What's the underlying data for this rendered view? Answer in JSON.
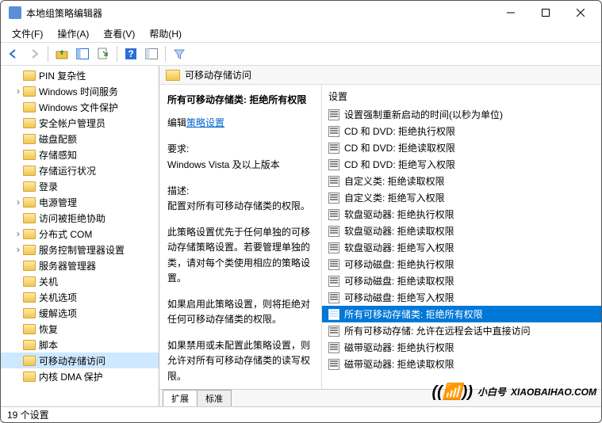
{
  "window": {
    "title": "本地组策略编辑器"
  },
  "menu": {
    "file": "文件(F)",
    "action": "操作(A)",
    "view": "查看(V)",
    "help": "帮助(H)"
  },
  "tree": {
    "items": [
      {
        "label": "PIN 复杂性",
        "exp": ""
      },
      {
        "label": "Windows 时间服务",
        "exp": "›"
      },
      {
        "label": "Windows 文件保护",
        "exp": ""
      },
      {
        "label": "安全帐户管理员",
        "exp": ""
      },
      {
        "label": "磁盘配额",
        "exp": ""
      },
      {
        "label": "存储感知",
        "exp": ""
      },
      {
        "label": "存储运行状况",
        "exp": ""
      },
      {
        "label": "登录",
        "exp": ""
      },
      {
        "label": "电源管理",
        "exp": "›"
      },
      {
        "label": "访问被拒绝协助",
        "exp": ""
      },
      {
        "label": "分布式 COM",
        "exp": "›"
      },
      {
        "label": "服务控制管理器设置",
        "exp": "›"
      },
      {
        "label": "服务器管理器",
        "exp": ""
      },
      {
        "label": "关机",
        "exp": ""
      },
      {
        "label": "关机选项",
        "exp": ""
      },
      {
        "label": "缓解选项",
        "exp": ""
      },
      {
        "label": "恢复",
        "exp": ""
      },
      {
        "label": "脚本",
        "exp": ""
      },
      {
        "label": "可移动存储访问",
        "exp": "",
        "selected": true
      },
      {
        "label": "内核 DMA 保护",
        "exp": ""
      }
    ]
  },
  "header": {
    "title": "可移动存储访问"
  },
  "detail": {
    "title": "所有可移动存储类: 拒绝所有权限",
    "edit_prefix": "编辑",
    "edit_link": "策略设置",
    "req_label": "要求:",
    "req_text": "Windows Vista 及以上版本",
    "desc_label": "描述:",
    "desc_text": "配置对所有可移动存储类的权限。",
    "para1": "此策略设置优先于任何单独的可移动存储策略设置。若要管理单独的类，请对每个类使用相应的策略设置。",
    "para2": "如果启用此策略设置，则将拒绝对任何可移动存储类的权限。",
    "para3": "如果禁用或未配置此策略设置，则允许对所有可移动存储类的读写权限。"
  },
  "list": {
    "header": "设置",
    "items": [
      "设置强制重新启动的时间(以秒为单位)",
      "CD 和 DVD: 拒绝执行权限",
      "CD 和 DVD: 拒绝读取权限",
      "CD 和 DVD: 拒绝写入权限",
      "自定义类: 拒绝读取权限",
      "自定义类: 拒绝写入权限",
      "软盘驱动器: 拒绝执行权限",
      "软盘驱动器: 拒绝读取权限",
      "软盘驱动器: 拒绝写入权限",
      "可移动磁盘: 拒绝执行权限",
      "可移动磁盘: 拒绝读取权限",
      "可移动磁盘: 拒绝写入权限",
      "所有可移动存储类: 拒绝所有权限",
      "所有可移动存储: 允许在远程会话中直接访问",
      "磁带驱动器: 拒绝执行权限",
      "磁带驱动器: 拒绝读取权限"
    ],
    "selected_index": 12
  },
  "tabs": {
    "extended": "扩展",
    "standard": "标准"
  },
  "status": {
    "text": "19 个设置"
  },
  "watermark": {
    "text": "小白号",
    "url": "XIAOBAIHAO.COM"
  }
}
